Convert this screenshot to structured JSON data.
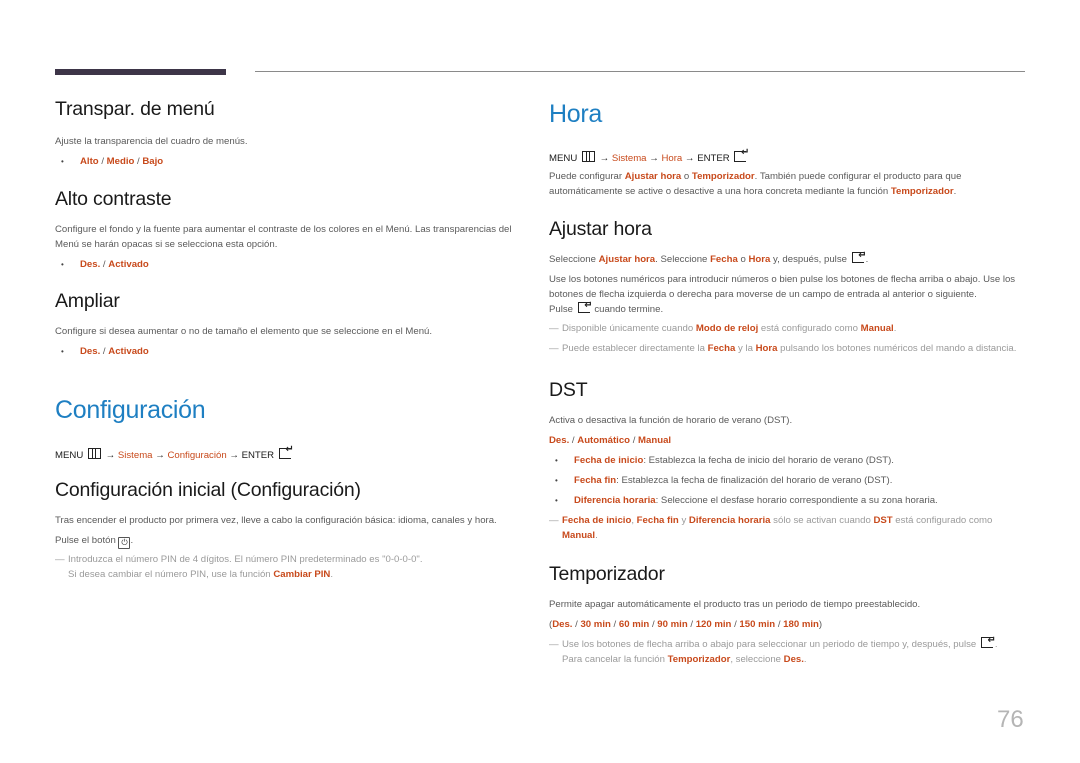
{
  "page_number": "76",
  "colors": {
    "heading_blue": "#1e7fc2",
    "highlight_orange": "#c84a1c",
    "bar_dark": "#3d3548"
  },
  "left": {
    "transpar": {
      "title": "Transpar. de menú",
      "desc": "Ajuste la transparencia del cuadro de menús.",
      "options": [
        "Alto",
        "Medio",
        "Bajo"
      ]
    },
    "alto_contraste": {
      "title": "Alto contraste",
      "desc": "Configure el fondo y la fuente para aumentar el contraste de los colores en el Menú. Las transparencias del Menú se harán opacas si se selecciona esta opción.",
      "options": [
        "Des.",
        "Activado"
      ]
    },
    "ampliar": {
      "title": "Ampliar",
      "desc": "Configure si desea aumentar o no de tamaño el elemento que se seleccione en el Menú.",
      "options": [
        "Des.",
        "Activado"
      ]
    },
    "configuracion": {
      "title": "Configuración",
      "path": {
        "menu": "MENU",
        "arrow": "→",
        "sistema": "Sistema",
        "item": "Configuración",
        "enter": "ENTER"
      }
    },
    "config_inicial": {
      "title": "Configuración inicial (Configuración)",
      "desc": "Tras encender el producto por primera vez, lleve a cabo la configuración básica: idioma, canales y hora.",
      "press_prefix": "Pulse el botón",
      "press_suffix": ".",
      "power_icon": "⏻",
      "note_line1": "Introduzca el número PIN de 4 dígitos. El número PIN predeterminado es \"0-0-0-0\".",
      "note_line2_prefix": "Si desea cambiar el número PIN, use la función",
      "note_line2_link": "Cambiar PIN",
      "note_line2_suffix": "."
    }
  },
  "right": {
    "hora": {
      "title": "Hora",
      "path": {
        "menu": "MENU",
        "arrow": "→",
        "sistema": "Sistema",
        "item": "Hora",
        "enter": "ENTER"
      },
      "desc_parts": [
        "Puede configurar ",
        "Ajustar hora",
        " o ",
        "Temporizador",
        ". También puede configurar el producto para que automáticamente se active o desactive a una hora concreta mediante la función ",
        "Temporizador",
        "."
      ]
    },
    "ajustar_hora": {
      "title": "Ajustar hora",
      "line1_parts": [
        "Seleccione ",
        "Ajustar hora",
        ". Seleccione ",
        "Fecha",
        " o ",
        "Hora",
        " y, después, pulse",
        "."
      ],
      "line2": "Use los botones numéricos para introducir números o bien pulse los botones de flecha arriba o abajo. Use los botones de flecha izquierda o derecha para moverse de un campo de entrada al anterior o siguiente.",
      "line3_prefix": "Pulse",
      "line3_suffix": "cuando termine.",
      "note1_parts": [
        "Disponible únicamente cuando ",
        "Modo de reloj",
        " está configurado como ",
        "Manual",
        "."
      ],
      "note2_parts": [
        "Puede establecer directamente la ",
        "Fecha",
        " y la ",
        "Hora",
        " pulsando los botones numéricos del mando a distancia."
      ]
    },
    "dst": {
      "title": "DST",
      "desc": "Activa o desactiva la función de horario de verano (DST).",
      "options": [
        "Des.",
        "Automático",
        "Manual"
      ],
      "bullets": [
        {
          "label": "Fecha de inicio",
          "text": ": Establezca la fecha de inicio del horario de verano (DST)."
        },
        {
          "label": "Fecha fin",
          "text": ": Establezca la fecha de finalización del horario de verano (DST)."
        },
        {
          "label": "Diferencia horaria",
          "text": ": Seleccione el desfase horario correspondiente a su zona horaria."
        }
      ],
      "note_parts": [
        "Fecha de inicio",
        ", ",
        "Fecha fin",
        " y ",
        "Diferencia horaria",
        " sólo se activan cuando ",
        "DST",
        " está configurado como ",
        "Manual",
        "."
      ]
    },
    "temporizador": {
      "title": "Temporizador",
      "desc": "Permite apagar automáticamente el producto tras un periodo de tiempo preestablecido.",
      "options": [
        "Des.",
        "30 min",
        "60 min",
        "90 min",
        "120 min",
        "150 min",
        "180 min"
      ],
      "note_line1": "Use los botones de flecha arriba o abajo para seleccionar un periodo de tiempo y, después, pulse",
      "note_line2_parts": [
        "Para cancelar la función ",
        "Temporizador",
        ", seleccione ",
        "Des.",
        "."
      ]
    }
  },
  "separator": " / ",
  "note_dash": "—"
}
